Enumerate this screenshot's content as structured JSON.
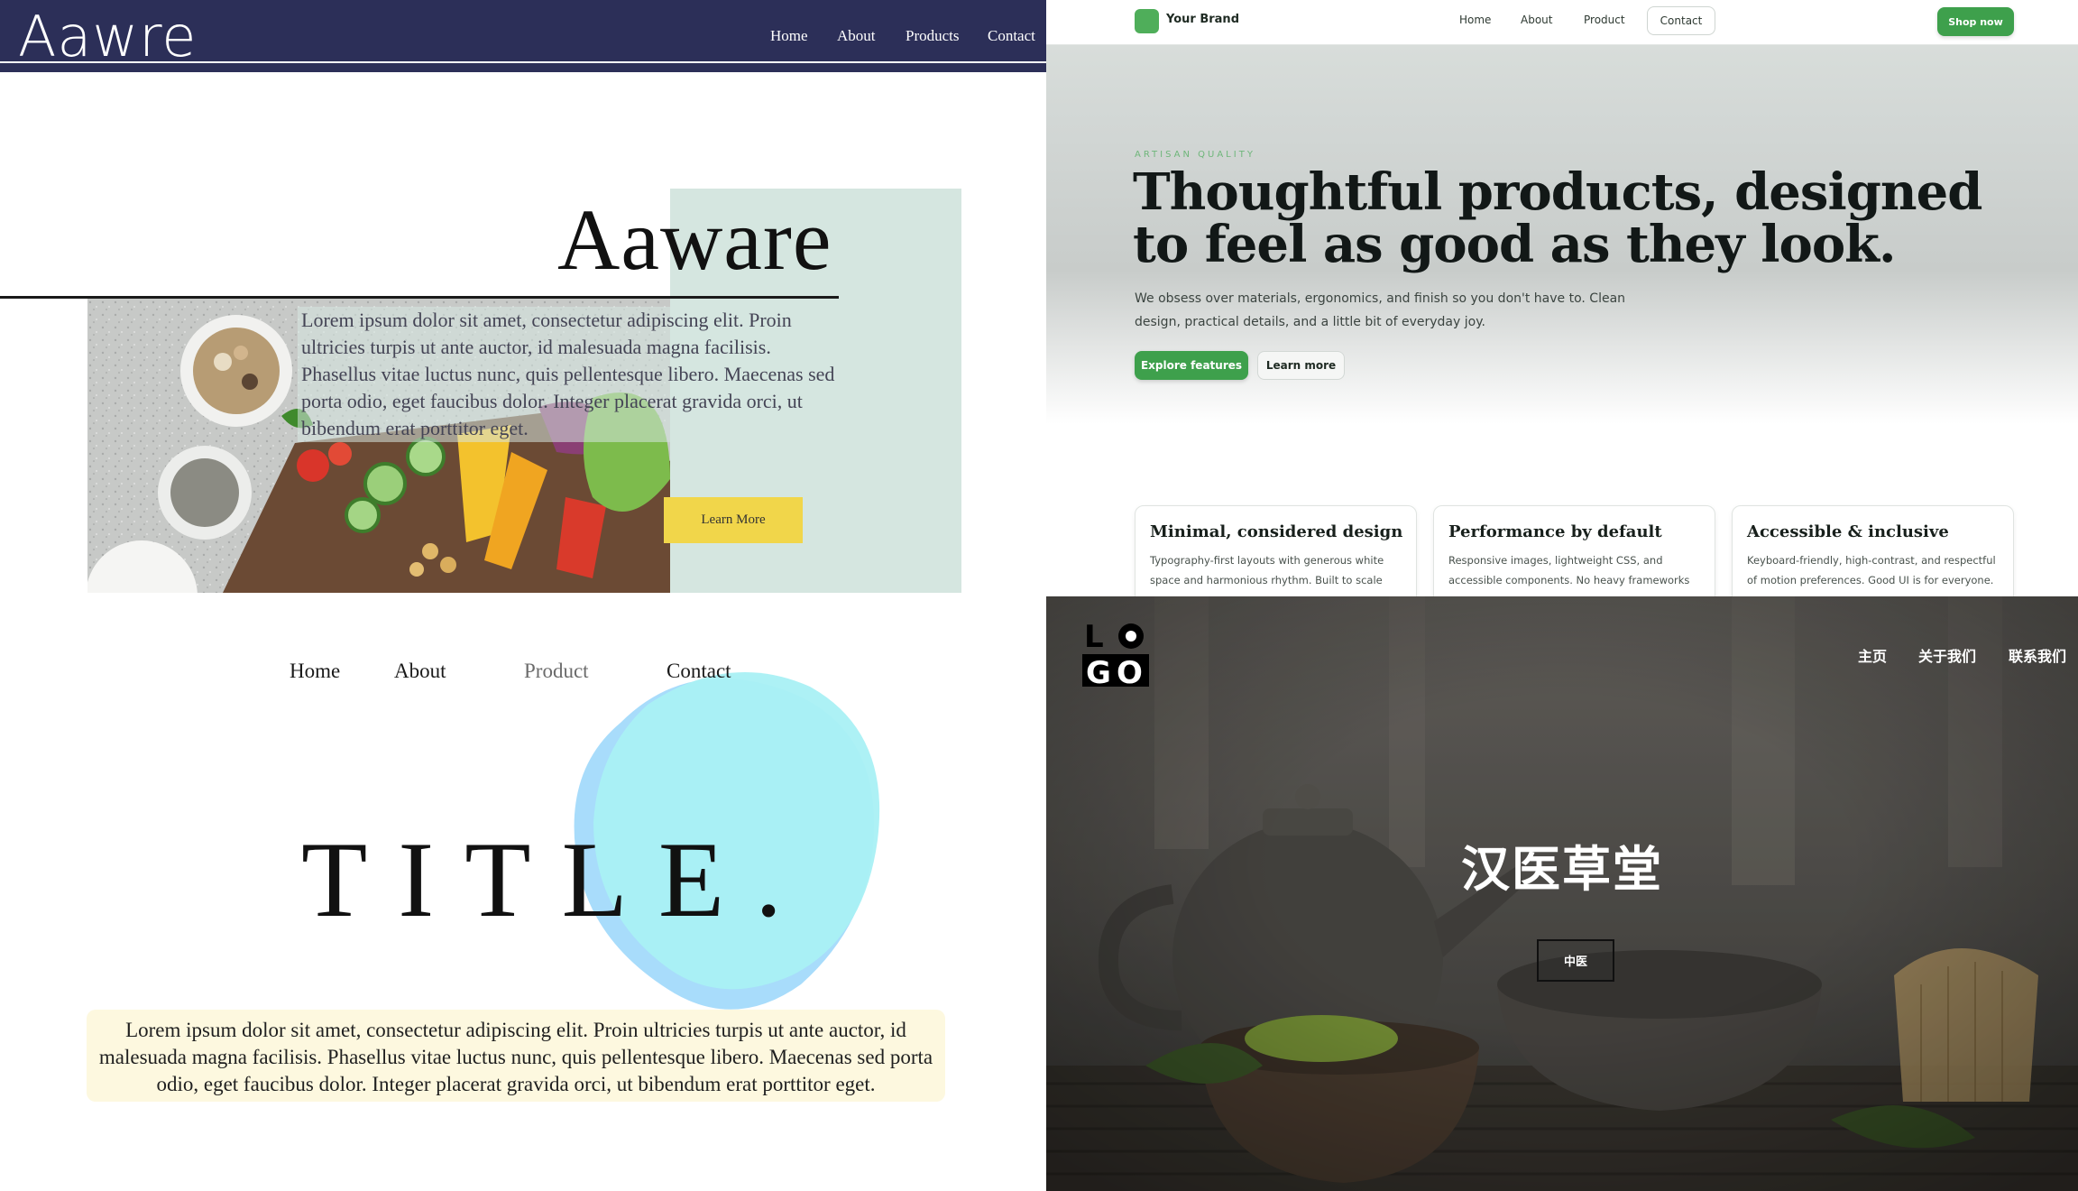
{
  "panel1": {
    "logo": "Aawre",
    "nav": [
      "Home",
      "About",
      "Products",
      "Contact"
    ],
    "hero_title": "Aaware",
    "paragraph": "Lorem ipsum dolor sit amet, consectetur adipiscing elit. Proin ultricies turpis ut ante auctor, id malesuada magna facilisis. Phasellus vitae luctus nunc, quis pellentesque libero. Maecenas sed porta odio, eget faucibus dolor. Integer placerat gravida orci, ut bibendum erat porttitor eget.",
    "cta_label": "Learn More",
    "colors": {
      "navbar": "#2c2f58",
      "mint": "#d5e6e0",
      "cta": "#f1d64a"
    }
  },
  "panel2": {
    "brand": "Your Brand",
    "nav": [
      "Home",
      "About",
      "Product"
    ],
    "nav_contact": "Contact",
    "shop_label": "Shop now",
    "eyebrow": "ARTISAN QUALITY",
    "headline": "Thoughtful products, designed to feel as good as they look.",
    "lede": "We obsess over materials, ergonomics, and finish so you don't have to. Clean design, practical details, and a little bit of everyday joy.",
    "primary_label": "Explore features",
    "secondary_label": "Learn more",
    "cards": [
      {
        "title": "Minimal, considered design",
        "body": "Typography-first layouts with generous white space and harmonious rhythm. Built to scale"
      },
      {
        "title": "Performance by default",
        "body": "Responsive images, lightweight CSS, and accessible components. No heavy frameworks"
      },
      {
        "title": "Accessible & inclusive",
        "body": "Keyboard-friendly, high-contrast, and respectful of motion preferences. Good UI is for everyone."
      }
    ],
    "colors": {
      "accent": "#3ea04c"
    }
  },
  "panel3": {
    "nav": [
      "Home",
      "About",
      "Product",
      "Contact"
    ],
    "title": "TITLE.",
    "paragraph": "Lorem ipsum dolor sit amet, consectetur adipiscing elit. Proin ultricies turpis ut ante auctor, id malesuada magna facilisis. Phasellus vitae luctus nunc, quis pellentesque libero. Maecenas sed porta odio, eget faucibus dolor. Integer placerat gravida orci, ut bibendum erat porttitor eget.",
    "colors": {
      "blob": "#a9f0f4",
      "blob_back": "#9fd8fb",
      "paragraph_bg": "#fdf8df"
    }
  },
  "panel4": {
    "logo_letters": [
      "L",
      "O",
      "G",
      "O"
    ],
    "nav": [
      "主页",
      "关于我们",
      "联系我们"
    ],
    "title": "汉医草堂",
    "tag": "中医"
  }
}
